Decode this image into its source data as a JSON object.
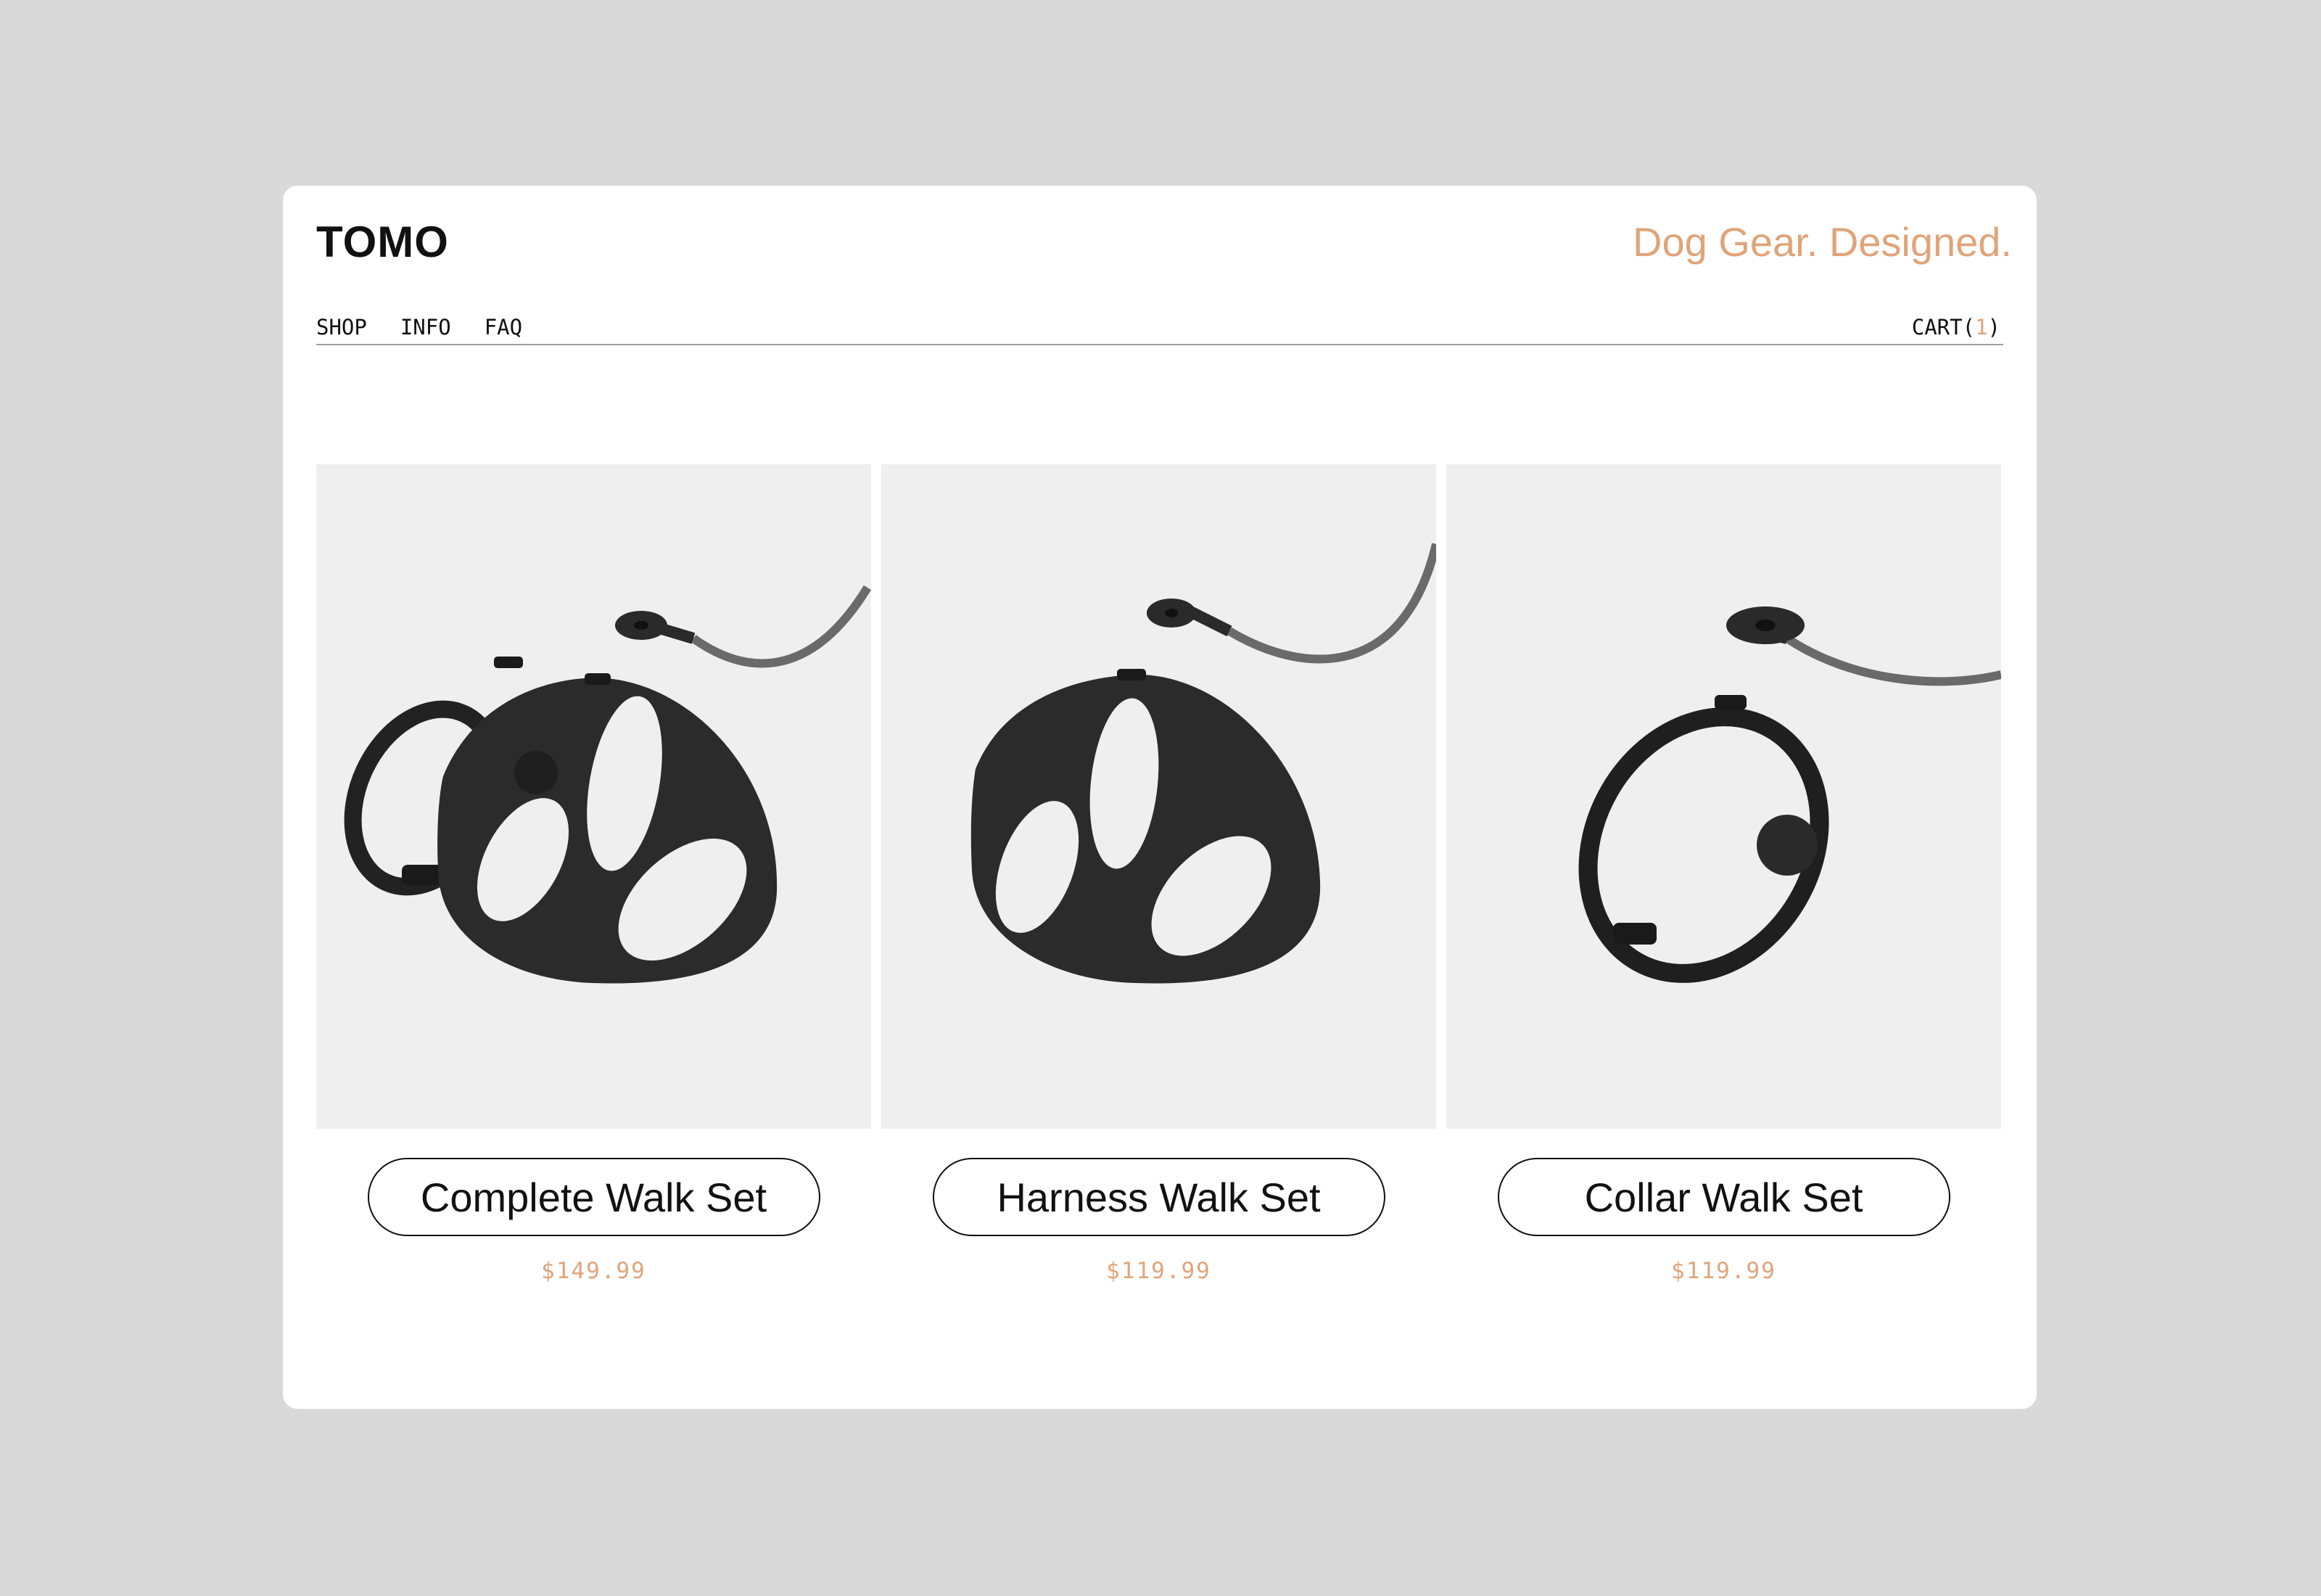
{
  "brand": {
    "logo": "TOMO",
    "tagline": "Dog Gear. Designed."
  },
  "nav": {
    "items": [
      "SHOP",
      "INFO",
      "FAQ"
    ]
  },
  "cart": {
    "label": "CART(",
    "count": "1",
    "close": ")"
  },
  "products": [
    {
      "name": "Complete Walk Set",
      "price": "$149.99",
      "image": "harness-collar-leash-photo"
    },
    {
      "name": "Harness Walk Set",
      "price": "$119.99",
      "image": "harness-leash-photo"
    },
    {
      "name": "Collar Walk Set",
      "price": "$119.99",
      "image": "collar-leash-photo"
    }
  ],
  "colors": {
    "accent": "#e0a47a",
    "page_bg": "#d9d9d9",
    "photo_bg": "#efefef",
    "ink": "#111111"
  }
}
